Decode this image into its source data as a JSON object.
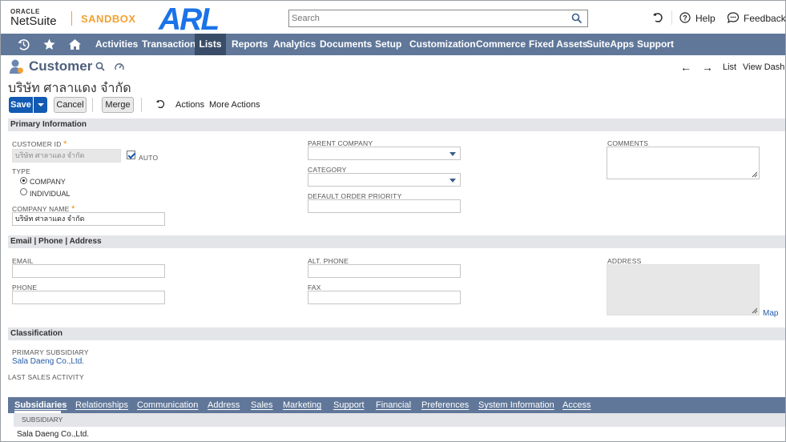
{
  "header": {
    "oracle": "ORACLE",
    "netsuite": "NetSuite",
    "sandbox": "SANDBOX",
    "arl_logo": "ARL",
    "search_placeholder": "Search",
    "help": "Help",
    "feedback": "Feedback"
  },
  "nav": {
    "items": [
      "Activities",
      "Transactions",
      "Lists",
      "Reports",
      "Analytics",
      "Documents",
      "Setup",
      "Customization",
      "Commerce",
      "Fixed Assets",
      "SuiteApps",
      "Support"
    ],
    "active": "Lists"
  },
  "record": {
    "type_title": "Customer",
    "name": "บริษัท ศาลาแดง จำกัด",
    "list_link": "List",
    "view_dash": "View Dashb"
  },
  "toolbar": {
    "save": "Save",
    "cancel": "Cancel",
    "merge": "Merge",
    "actions": "Actions",
    "more_actions": "More Actions"
  },
  "primary": {
    "section_title": "Primary Information",
    "customer_id_label": "CUSTOMER ID",
    "customer_id_value": "บริษัท ศาลาแดง จำกัด",
    "auto_label": "AUTO",
    "type_label": "TYPE",
    "type_company": "COMPANY",
    "type_individual": "INDIVIDUAL",
    "company_name_label": "COMPANY NAME",
    "company_name_value": "บริษัท ศาลาแดง จำกัด",
    "parent_company_label": "PARENT COMPANY",
    "category_label": "CATEGORY",
    "default_priority_label": "DEFAULT ORDER PRIORITY",
    "comments_label": "COMMENTS",
    "required_marker": "*"
  },
  "contact": {
    "section_title": "Email | Phone | Address",
    "email_label": "EMAIL",
    "phone_label": "PHONE",
    "alt_phone_label": "ALT. PHONE",
    "fax_label": "FAX",
    "address_label": "ADDRESS",
    "map_link": "Map"
  },
  "classification": {
    "section_title": "Classification",
    "primary_subsidiary_label": "PRIMARY SUBSIDIARY",
    "primary_subsidiary_value": "Sala Daeng Co.,Ltd.",
    "last_sales_label": "LAST SALES ACTIVITY"
  },
  "subtabs": {
    "items": [
      "Subsidiaries",
      "Relationships",
      "Communication",
      "Address",
      "Sales",
      "Marketing",
      "Support",
      "Financial",
      "Preferences",
      "System Information",
      "Access"
    ],
    "active": "Subsidiaries",
    "column_header": "SUBSIDIARY",
    "rows": [
      "Sala Daeng Co.,Ltd."
    ]
  },
  "colors": {
    "nav_bg": "#607799",
    "nav_active": "#3a4d68",
    "save_blue": "#125ab2",
    "section_bg": "#e4e5e9",
    "sandbox_orange": "#f3a133",
    "arl_blue": "#1a73e8"
  }
}
